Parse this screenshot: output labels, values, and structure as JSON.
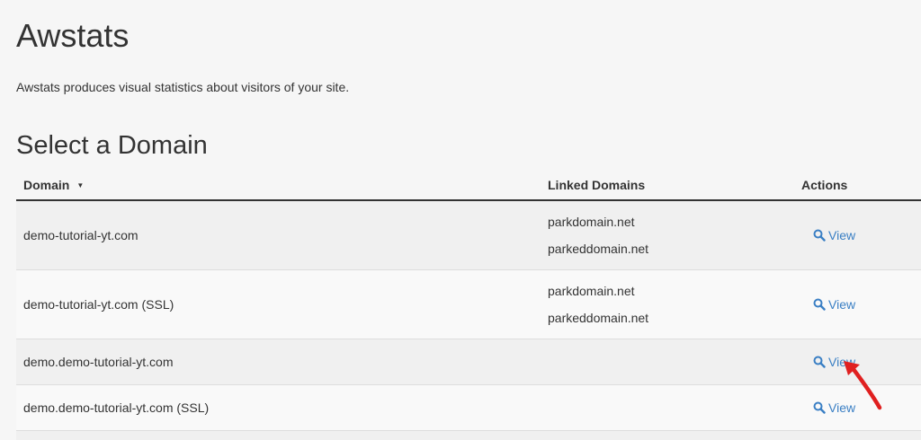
{
  "header": {
    "title": "Awstats",
    "description": "Awstats produces visual statistics about visitors of your site."
  },
  "section": {
    "title": "Select a Domain"
  },
  "table": {
    "columns": {
      "domain": "Domain",
      "linked": "Linked Domains",
      "actions": "Actions"
    },
    "sort_icon": "▼",
    "rows": [
      {
        "domain": "demo-tutorial-yt.com",
        "linked": [
          "parkdomain.net",
          "parkeddomain.net"
        ],
        "action": "View"
      },
      {
        "domain": "demo-tutorial-yt.com (SSL)",
        "linked": [
          "parkdomain.net",
          "parkeddomain.net"
        ],
        "action": "View"
      },
      {
        "domain": "demo.demo-tutorial-yt.com",
        "linked": [],
        "action": "View"
      },
      {
        "domain": "demo.demo-tutorial-yt.com (SSL)",
        "linked": [],
        "action": "View"
      }
    ]
  },
  "icons": {
    "view": "search-icon",
    "sort": "sort-down-icon",
    "annotation": "red-arrow"
  },
  "colors": {
    "link": "#3a7fc4",
    "annotation": "#e02020",
    "text": "#333333"
  }
}
